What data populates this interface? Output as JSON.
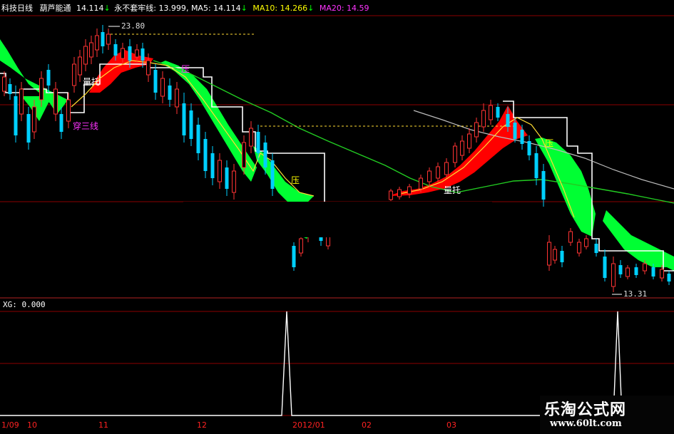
{
  "header": {
    "title": "科技日线",
    "items": [
      {
        "label": "葫芦能通",
        "value": "14.114",
        "arrow": "↓",
        "color": "#ffffff"
      },
      {
        "label": "永不套牢线:",
        "value": "13.999",
        "arrow": "",
        "color": "#ffffff"
      },
      {
        "label": "MA5:",
        "value": "14.114",
        "arrow": "↓",
        "color": "#ffffff"
      },
      {
        "label": "MA10:",
        "value": "14.266",
        "arrow": "↓",
        "color": "#ffff00"
      },
      {
        "label": "MA20:",
        "value": "14.59",
        "arrow": "",
        "color": "#ff33ff"
      }
    ]
  },
  "sub_panel": {
    "label": "XG:",
    "value": "0.000"
  },
  "annotations": {
    "high_price": "23.80",
    "low_price": "13.31",
    "chuan_san_xian": "穿三线",
    "liang_tuo_1": "量托",
    "liang_tuo_2": "量托",
    "ya_1": "压",
    "ya_2": "压",
    "ya_3": "压"
  },
  "watermark": {
    "title": "乐淘公式网",
    "url": "www.60lt.com"
  },
  "chart_data": {
    "type": "line",
    "x_axis_labels": [
      "1/09",
      "10",
      "11",
      "12",
      "2012/01",
      "02",
      "03"
    ],
    "main_panel": {
      "high_marker": 23.8,
      "low_marker": 13.31,
      "series": [
        {
          "name": "MA5",
          "last": 14.114,
          "color": "#ffffff"
        },
        {
          "name": "MA10",
          "last": 14.266,
          "color": "#ffff00"
        },
        {
          "name": "MA20",
          "last": 14.59,
          "color": "#ff33ff"
        },
        {
          "name": "永不套牢线",
          "last": 13.999,
          "color": "#ffffff"
        }
      ]
    },
    "sub_panel": {
      "series_name": "XG",
      "current": 0.0,
      "signals": [
        {
          "x_label": "2012/01",
          "value": 1
        },
        {
          "x_label": "03",
          "value": 1
        }
      ]
    },
    "colors": {
      "up_band": "#ff0000",
      "down_band": "#00ff00",
      "grid": "#8b0000",
      "candle_up": "#ff3333",
      "candle_down": "#00d0ff"
    }
  }
}
